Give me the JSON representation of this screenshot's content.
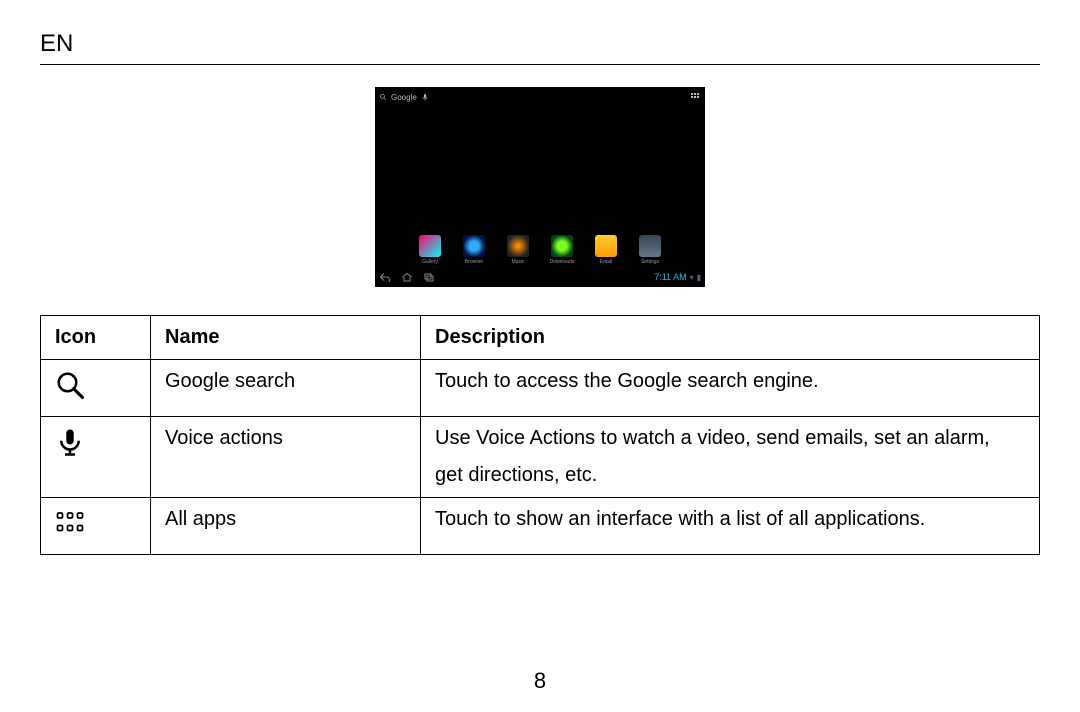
{
  "header": {
    "lang": "EN"
  },
  "tablet": {
    "search_label": "Google",
    "clock": "7:11 AM",
    "dock": [
      {
        "label": "Gallery"
      },
      {
        "label": "Browser"
      },
      {
        "label": "Music"
      },
      {
        "label": "Downloads"
      },
      {
        "label": "Email"
      },
      {
        "label": "Settings"
      }
    ]
  },
  "table": {
    "headers": {
      "icon": "Icon",
      "name": "Name",
      "description": "Description"
    },
    "rows": [
      {
        "icon_id": "search-icon",
        "name": "Google search",
        "description": "Touch to access the Google search engine."
      },
      {
        "icon_id": "voice-icon",
        "name": "Voice actions",
        "description": "Use Voice Actions to watch a video, send emails, set an alarm,",
        "description2": "get directions, etc."
      },
      {
        "icon_id": "all-apps-icon",
        "name": "All apps",
        "description": "Touch to show an interface with a list of all applications."
      }
    ]
  },
  "page_number": "8"
}
